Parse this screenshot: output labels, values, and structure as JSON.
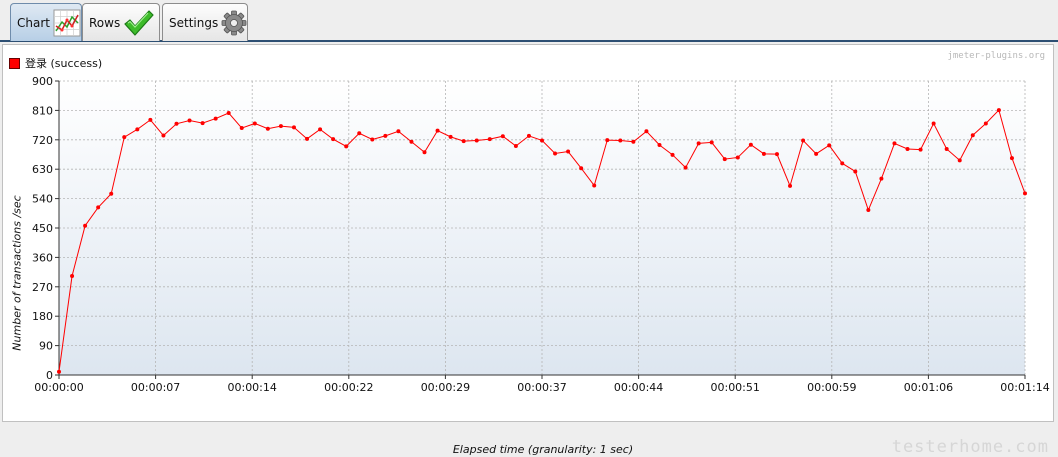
{
  "tabs": [
    {
      "label": "Chart",
      "icon": "line-chart-icon",
      "active": true
    },
    {
      "label": "Rows",
      "icon": "checkmark-icon",
      "active": false
    },
    {
      "label": "Settings",
      "icon": "gear-icon",
      "active": false
    }
  ],
  "watermark_top": "jmeter-plugins.org",
  "watermark_bottom": "testerhome.com",
  "colors": {
    "series": "#ff0000",
    "tab_border": "#2d4f73"
  },
  "chart_data": {
    "type": "line",
    "title": "",
    "legend_position": "top-left",
    "grid": true,
    "xlabel": "Elapsed time (granularity: 1 sec)",
    "ylabel": "Number of transactions /sec",
    "ylim": [
      0,
      900
    ],
    "xlim": [
      0,
      74
    ],
    "y_ticks": [
      "0",
      "90",
      "180",
      "270",
      "360",
      "450",
      "540",
      "630",
      "720",
      "810",
      "900"
    ],
    "x_ticks": [
      {
        "t": 0,
        "label": "00:00:00"
      },
      {
        "t": 7.4,
        "label": "00:00:07"
      },
      {
        "t": 14.8,
        "label": "00:00:14"
      },
      {
        "t": 22.2,
        "label": "00:00:22"
      },
      {
        "t": 29.6,
        "label": "00:00:29"
      },
      {
        "t": 37,
        "label": "00:00:37"
      },
      {
        "t": 44.4,
        "label": "00:00:44"
      },
      {
        "t": 51.8,
        "label": "00:00:51"
      },
      {
        "t": 59.2,
        "label": "00:00:59"
      },
      {
        "t": 66.6,
        "label": "00:01:06"
      },
      {
        "t": 74,
        "label": "00:01:14"
      }
    ],
    "series": [
      {
        "name": "登录 (success)",
        "values": [
          10,
          303,
          457,
          513,
          555,
          728,
          752,
          781,
          733,
          769,
          779,
          771,
          785,
          802,
          756,
          770,
          754,
          762,
          758,
          723,
          752,
          722,
          700,
          740,
          721,
          732,
          746,
          714,
          682,
          748,
          729,
          716,
          718,
          722,
          731,
          701,
          732,
          718,
          678,
          684,
          633,
          580,
          719,
          718,
          714,
          746,
          704,
          674,
          635,
          709,
          712,
          661,
          666,
          705,
          677,
          676,
          579,
          718,
          677,
          703,
          648,
          623,
          505,
          601,
          709,
          692,
          690,
          770,
          692,
          657,
          734,
          770,
          811,
          664,
          556
        ]
      }
    ]
  }
}
